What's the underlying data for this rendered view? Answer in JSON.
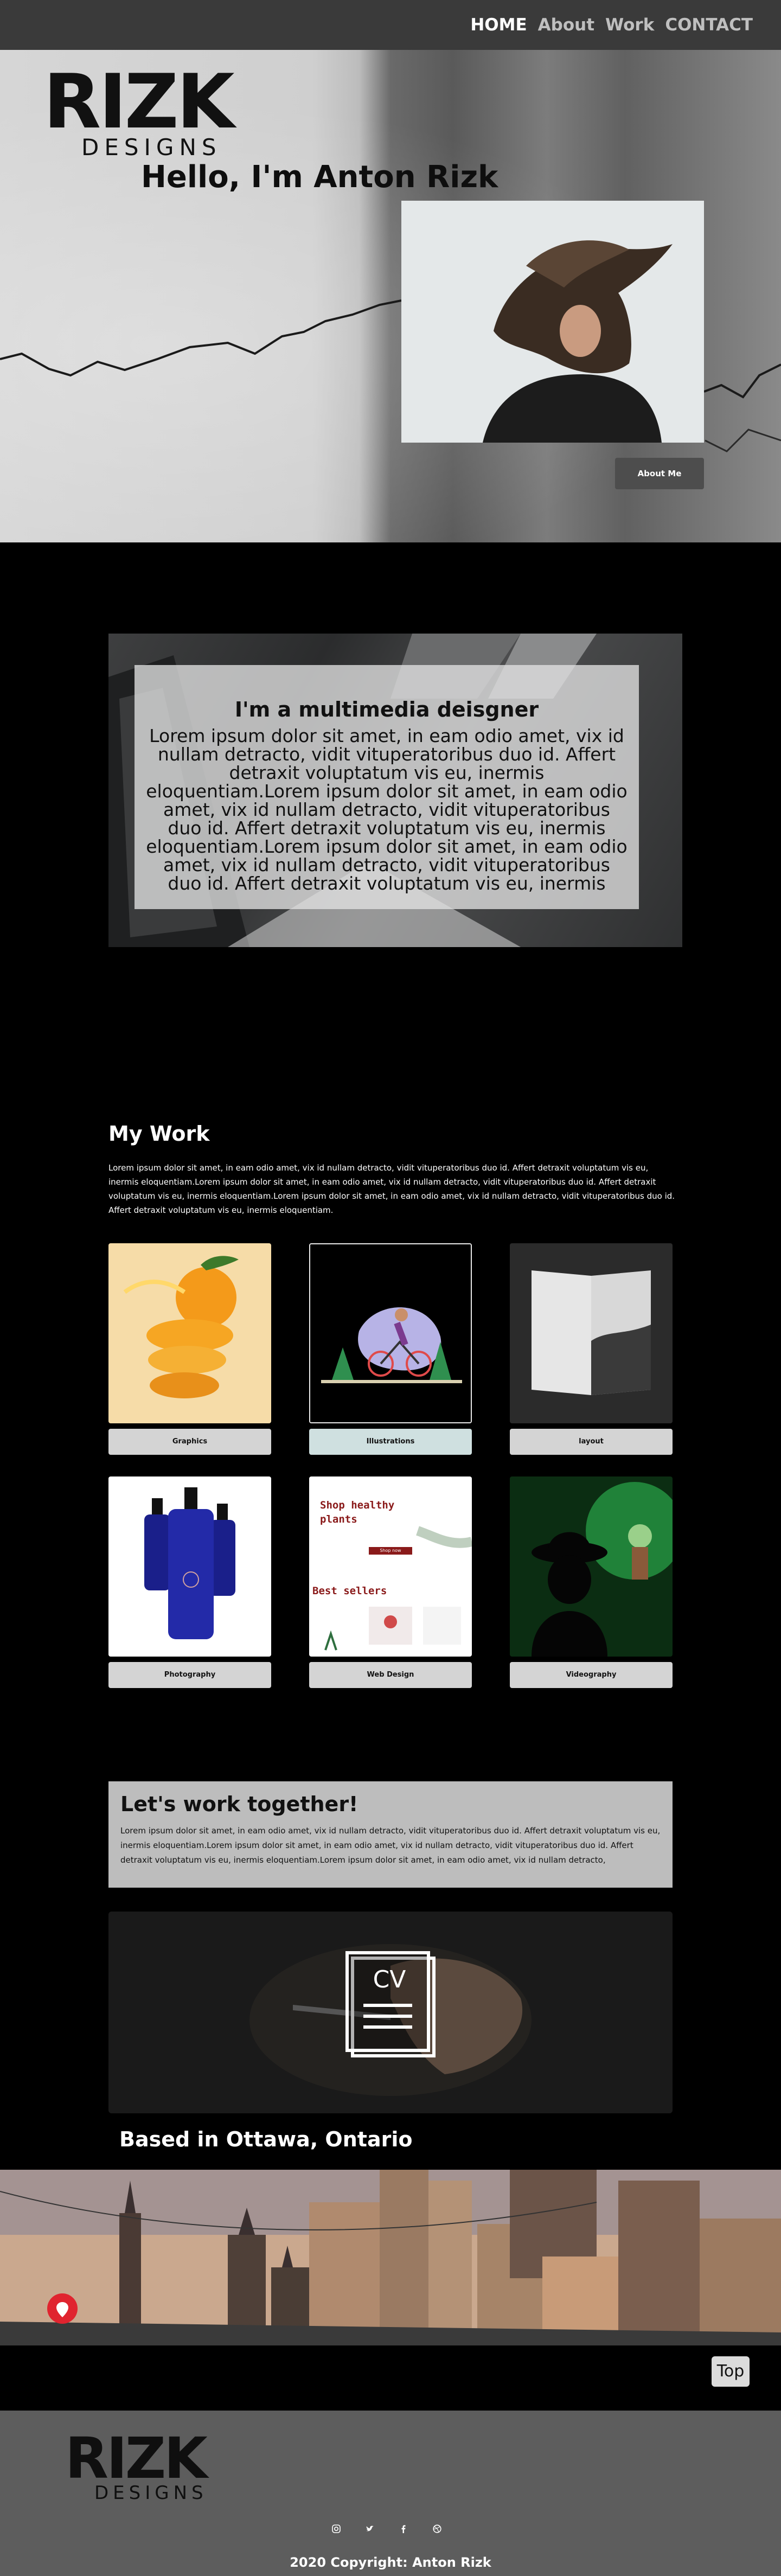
{
  "nav": {
    "links": [
      {
        "label": "HOME"
      },
      {
        "label": "About"
      },
      {
        "label": "Work"
      },
      {
        "label": "CONTACT"
      }
    ]
  },
  "hero": {
    "logo_main": "RIZK",
    "logo_sub": "DESIGNS",
    "title": "Hello, I'm Anton Rizk",
    "about_button": "About Me"
  },
  "intro": {
    "title": "I'm a multimedia deisgner",
    "text": "Lorem ipsum dolor sit amet, in eam odio amet, vix id nullam detracto, vidit vituperatoribus duo id. Affert detraxit voluptatum vis eu, inermis eloquentiam.Lorem ipsum dolor sit amet, in eam odio amet, vix id nullam detracto, vidit vituperatoribus duo id. Affert detraxit voluptatum vis eu, inermis eloquentiam.Lorem ipsum dolor sit amet, in eam odio amet, vix id nullam detracto, vidit vituperatoribus duo id. Affert detraxit voluptatum vis eu, inermis"
  },
  "work": {
    "title": "My Work",
    "text": "Lorem ipsum dolor sit amet, in eam odio amet, vix id nullam detracto, vidit vituperatoribus duo id. Affert detraxit voluptatum vis eu, inermis eloquentiam.Lorem ipsum dolor sit amet, in eam odio amet, vix id nullam detracto, vidit vituperatoribus duo id. Affert detraxit voluptatum vis eu, inermis eloquentiam.Lorem ipsum dolor sit amet, in eam odio amet, vix id nullam detracto, vidit vituperatoribus duo id. Affert detraxit voluptatum vis eu, inermis eloquentiam.",
    "cards": [
      {
        "label": "Graphics"
      },
      {
        "label": "Illustrations"
      },
      {
        "label": "layout"
      },
      {
        "label": "Photography"
      },
      {
        "label": "Web Design"
      },
      {
        "label": "Videography"
      }
    ],
    "web_thumb": {
      "headline": "Shop healthy plants",
      "button": "Shop now",
      "section": "Best sellers"
    }
  },
  "together": {
    "title": "Let's work together!",
    "text": "Lorem ipsum dolor sit amet, in eam odio amet, vix id nullam detracto, vidit vituperatoribus duo id. Affert detraxit voluptatum vis eu, inermis eloquentiam.Lorem ipsum dolor sit amet, in eam odio amet, vix id nullam detracto, vidit vituperatoribus duo id. Affert detraxit voluptatum vis eu, inermis eloquentiam.Lorem ipsum dolor sit amet, in eam odio amet, vix id nullam detracto,"
  },
  "cv": {
    "label": "CV"
  },
  "location": {
    "title": "Based in Ottawa, Ontario"
  },
  "top_button": "Top",
  "footer": {
    "logo_main": "RIZK",
    "logo_sub": "DESIGNS",
    "socials": [
      "instagram-icon",
      "twitter-icon",
      "facebook-icon",
      "dribbble-icon"
    ],
    "copyright": "2020 Copyright:  Anton Rizk"
  },
  "colors": {
    "nav_bg": "#3a3a3a",
    "page_bg": "#000000",
    "footer_bg": "#5d5d5d",
    "card_label_bg": "#d4d4d4",
    "together_bg": "#bdbdbd",
    "marker_red": "#e0242f"
  }
}
